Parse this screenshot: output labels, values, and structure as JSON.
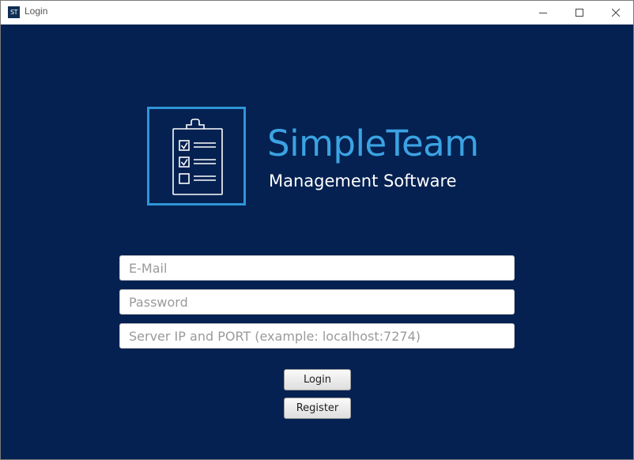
{
  "window": {
    "icon_text": "ST",
    "title": "Login",
    "controls": [
      "minimize-icon",
      "maximize-icon",
      "close-icon"
    ]
  },
  "brand": {
    "title": "SimpleTeam",
    "subtitle": "Management Software",
    "logo_icon": "clipboard-checklist-icon"
  },
  "form": {
    "email": {
      "value": "",
      "placeholder": "E-Mail"
    },
    "password": {
      "value": "",
      "placeholder": "Password"
    },
    "server": {
      "value": "",
      "placeholder": "Server IP and PORT (example: localhost:7274)"
    },
    "login_label": "Login",
    "register_label": "Register"
  },
  "colors": {
    "background": "#042151",
    "accent": "#2f95d6",
    "brand_title": "#3ba3e3"
  }
}
